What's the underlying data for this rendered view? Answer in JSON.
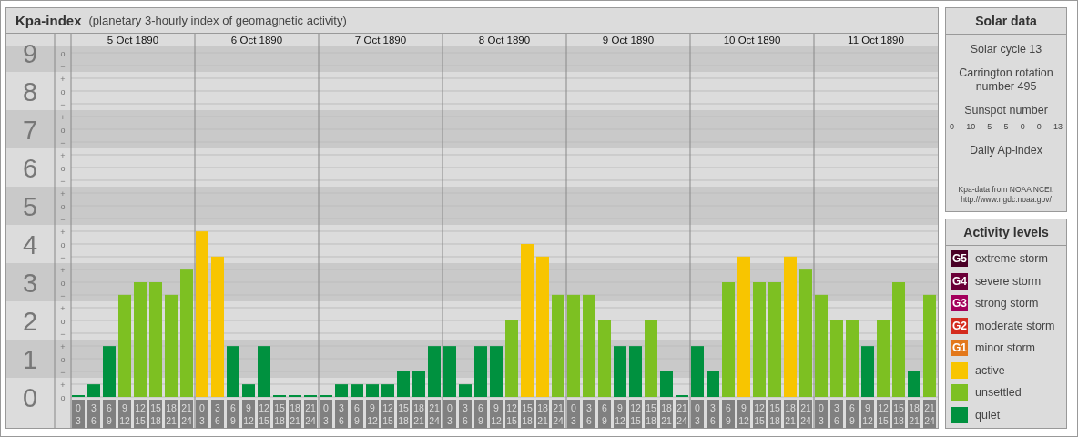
{
  "kpa_panel": {
    "title": "Kpa-index",
    "subtitle": "(planetary 3-hourly index of geomagnetic activity)",
    "sublevel_marks": [
      "o",
      "−",
      "+",
      "o",
      "−",
      "+",
      "o",
      "−",
      "+",
      "o",
      "−",
      "+",
      "o",
      "−",
      "+",
      "o",
      "−",
      "+",
      "o",
      "−",
      "+",
      "o",
      "−",
      "+",
      "o",
      "−",
      "+",
      "o"
    ],
    "days": [
      "5 Oct 1890",
      "6 Oct 1890",
      "7 Oct 1890",
      "8 Oct 1890",
      "9 Oct 1890",
      "10 Oct 1890",
      "11 Oct 1890"
    ],
    "chart_data": {
      "type": "bar",
      "grid": true,
      "ylim": [
        0,
        9.5
      ],
      "yticks": [
        0,
        1,
        2,
        3,
        4,
        5,
        6,
        7,
        8,
        9
      ],
      "categories": [
        "0\n3",
        "3\n6",
        "6\n9",
        "9\n12",
        "12\n15",
        "15\n18",
        "18\n21",
        "21\n24",
        "0\n3",
        "3\n6",
        "6\n9",
        "9\n12",
        "12\n15",
        "15\n18",
        "18\n21",
        "21\n24",
        "0\n3",
        "3\n6",
        "6\n9",
        "9\n12",
        "12\n15",
        "15\n18",
        "18\n21",
        "21\n24",
        "0\n3",
        "3\n6",
        "6\n9",
        "9\n12",
        "12\n15",
        "15\n18",
        "18\n21",
        "21\n24",
        "0\n3",
        "3\n6",
        "6\n9",
        "9\n12",
        "12\n15",
        "15\n18",
        "18\n21",
        "21\n24",
        "0\n3",
        "3\n6",
        "6\n9",
        "9\n12",
        "12\n15",
        "15\n18",
        "18\n21",
        "21\n24",
        "0\n3",
        "3\n6",
        "6\n9",
        "9\n12",
        "12\n15",
        "15\n18",
        "18\n21",
        "21\n24"
      ],
      "series": [
        {
          "color": "#00913f",
          "values": [
            0,
            0.33,
            1.33,
            null,
            null,
            null,
            null,
            null,
            null,
            null,
            1.33,
            0.33,
            1.33,
            0,
            0,
            0,
            0,
            0.33,
            0.33,
            0.33,
            0.33,
            0.67,
            0.67,
            1.33,
            1.33,
            0.33,
            1.33,
            1.33,
            null,
            null,
            null,
            null,
            null,
            null,
            null,
            1.33,
            1.33,
            null,
            0.67,
            0,
            1.33,
            0.67,
            null,
            null,
            null,
            null,
            null,
            null,
            null,
            null,
            null,
            1.33,
            null,
            null,
            0.67,
            null
          ]
        },
        {
          "color": "#7dc022",
          "values": [
            null,
            null,
            null,
            2.67,
            3,
            3,
            2.67,
            3.33,
            null,
            null,
            null,
            null,
            null,
            null,
            null,
            null,
            null,
            null,
            null,
            null,
            null,
            null,
            null,
            null,
            null,
            null,
            null,
            null,
            2,
            null,
            null,
            2.67,
            2.67,
            2.67,
            2,
            null,
            null,
            2,
            null,
            null,
            null,
            null,
            3,
            null,
            3,
            3,
            null,
            3.33,
            2.67,
            2,
            2,
            null,
            2,
            3,
            null,
            2.67
          ]
        },
        {
          "color": "#f8c500",
          "values": [
            null,
            null,
            null,
            null,
            null,
            null,
            null,
            null,
            4.33,
            3.67,
            null,
            null,
            null,
            null,
            null,
            null,
            null,
            null,
            null,
            null,
            null,
            null,
            null,
            null,
            null,
            null,
            null,
            null,
            null,
            4,
            3.67,
            null,
            null,
            null,
            null,
            null,
            null,
            null,
            null,
            null,
            null,
            null,
            null,
            3.67,
            null,
            null,
            3.67,
            null,
            null,
            null,
            null,
            null,
            null,
            null,
            null,
            null
          ]
        }
      ]
    }
  },
  "solar_data": {
    "title": "Solar data",
    "solar_cycle": "Solar cycle 13",
    "carrington": "Carrington rotation number 495",
    "sunspot_label": "Sunspot number",
    "sunspot_numbers": [
      "0",
      "10",
      "5",
      "5",
      "0",
      "0",
      "13"
    ],
    "ap_label": "Daily Ap-index",
    "ap_values": [
      "--",
      "--",
      "--",
      "--",
      "--",
      "--",
      "--"
    ],
    "source": "Kpa-data from NOAA NCEI:",
    "source_url": "http://www.ngdc.noaa.gov/"
  },
  "activity_levels": {
    "title": "Activity levels",
    "items": [
      {
        "badge": "G5",
        "label": "extreme storm",
        "color": "#4a0026"
      },
      {
        "badge": "G4",
        "label": "severe storm",
        "color": "#6b0038"
      },
      {
        "badge": "G3",
        "label": "strong storm",
        "color": "#a3005c"
      },
      {
        "badge": "G2",
        "label": "moderate storm",
        "color": "#d42b1e"
      },
      {
        "badge": "G1",
        "label": "minor storm",
        "color": "#e3781b"
      },
      {
        "label": "active",
        "color": "#f8c500"
      },
      {
        "label": "unsettled",
        "color": "#7dc022"
      },
      {
        "label": "quiet",
        "color": "#00913f"
      }
    ]
  }
}
